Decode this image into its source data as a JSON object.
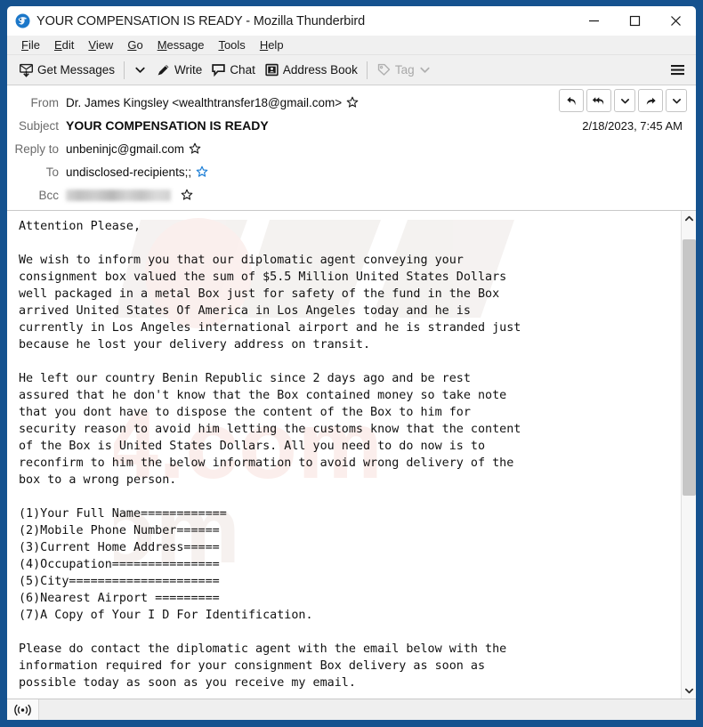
{
  "window": {
    "title": "YOUR COMPENSATION IS READY - Mozilla Thunderbird",
    "logo_icon": "thunderbird-logo-icon",
    "minimize_icon": "minimize-icon",
    "maximize_icon": "maximize-icon",
    "close_icon": "close-icon",
    "border_color": "#15528f"
  },
  "menu": {
    "items": [
      {
        "label": "File",
        "accesskey": "F"
      },
      {
        "label": "Edit",
        "accesskey": "E"
      },
      {
        "label": "View",
        "accesskey": "V"
      },
      {
        "label": "Go",
        "accesskey": "G"
      },
      {
        "label": "Message",
        "accesskey": "M"
      },
      {
        "label": "Tools",
        "accesskey": "T"
      },
      {
        "label": "Help",
        "accesskey": "H"
      }
    ]
  },
  "toolbar": {
    "get_messages_label": "Get Messages",
    "get_messages_icon": "download-mail-icon",
    "get_messages_chevron_icon": "chevron-down-icon",
    "write_label": "Write",
    "write_icon": "pencil-icon",
    "chat_label": "Chat",
    "chat_icon": "speech-bubble-icon",
    "address_book_label": "Address Book",
    "address_book_icon": "contact-card-icon",
    "tag_label": "Tag",
    "tag_icon": "tag-icon",
    "tag_chevron_icon": "chevron-down-icon",
    "tag_disabled": true,
    "app_menu_icon": "hamburger-menu-icon"
  },
  "message_header": {
    "from_label": "From",
    "from_value": "Dr. James Kingsley <wealthtransfer18@gmail.com>",
    "subject_label": "Subject",
    "subject_value": "YOUR COMPENSATION IS READY",
    "reply_to_label": "Reply to",
    "reply_to_value": "unbeninjc@gmail.com",
    "to_label": "To",
    "to_value": "undisclosed-recipients;;",
    "bcc_label": "Bcc",
    "bcc_value": "",
    "bcc_redacted": true,
    "date": "2/18/2023, 7:45 AM",
    "star_icon": "star-icon",
    "actions": [
      {
        "name": "reply-button",
        "icon": "reply-arrow-icon"
      },
      {
        "name": "reply-all-button",
        "icon": "reply-all-arrow-icon"
      },
      {
        "name": "reply-more-button",
        "icon": "chevron-down-icon"
      },
      {
        "name": "forward-button",
        "icon": "forward-arrow-icon"
      },
      {
        "name": "more-actions-button",
        "icon": "chevron-down-icon"
      }
    ]
  },
  "message_body": {
    "text": "Attention Please,\n\nWe wish to inform you that our diplomatic agent conveying your\nconsignment box valued the sum of $5.5 Million United States Dollars\nwell packaged in a metal Box just for safety of the fund in the Box\narrived United States Of America in Los Angeles today and he is\ncurrently in Los Angeles international airport and he is stranded just\nbecause he lost your delivery address on transit.\n\nHe left our country Benin Republic since 2 days ago and be rest\nassured that he don't know that the Box contained money so take note\nthat you dont have to dispose the content of the Box to him for\nsecurity reason to avoid him letting the customs know that the content\nof the Box is United States Dollars. All you need to do now is to\nreconfirm to him the below information to avoid wrong delivery of the\nbox to a wrong person.\n\n(1)Your Full Name============\n(2)Mobile Phone Number======\n(3)Current Home Address=====\n(4)Occupation===============\n(5)City=====================\n(6)Nearest Airport =========\n(7)A Copy of Your I D For Identification.\n\nPlease do contact the diplomatic agent with the email below with the\ninformation required for your consignment Box delivery as soon as\npossible today as soon as you receive my email."
  },
  "scrollbar": {
    "up_arrow_icon": "chevron-up-icon",
    "down_arrow_icon": "chevron-down-icon",
    "thumb_top_pct": 3,
    "thumb_height_pct": 56
  },
  "status_bar": {
    "connection_icon": "broadcast-signal-icon",
    "text": ""
  },
  "watermark": {
    "text": "pcrisk.com"
  }
}
